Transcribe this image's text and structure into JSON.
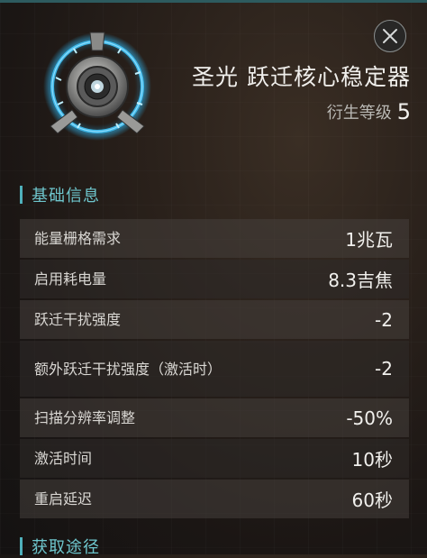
{
  "item": {
    "name": "圣光 跃迁核心稳定器",
    "level_label": "衍生等级",
    "level_value": "5",
    "icon": "warp-core-stabilizer-icon"
  },
  "close_icon": "close-icon",
  "sections": {
    "basic_info": "基础信息",
    "acquisition": "获取途径"
  },
  "attributes": [
    {
      "label": "能量栅格需求",
      "value": "1兆瓦"
    },
    {
      "label": "启用耗电量",
      "value": "8.3吉焦"
    },
    {
      "label": "跃迁干扰强度",
      "value": "-2"
    },
    {
      "label": "额外跃迁干扰强度（激活时）",
      "value": "-2"
    },
    {
      "label": "扫描分辨率调整",
      "value": "-50%"
    },
    {
      "label": "激活时间",
      "value": "10秒"
    },
    {
      "label": "重启延迟",
      "value": "60秒"
    }
  ],
  "colors": {
    "accent": "#6ec6cd",
    "ring": "#3fb8e8"
  }
}
